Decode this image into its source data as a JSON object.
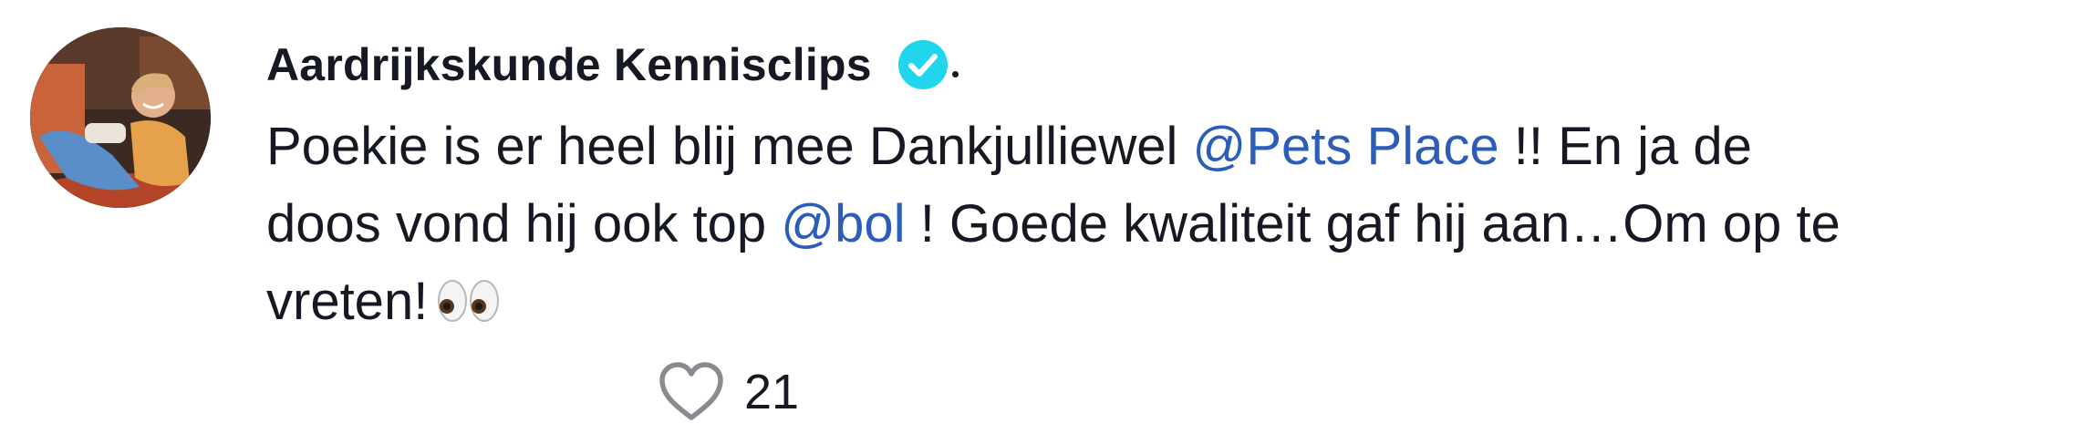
{
  "comment": {
    "author": {
      "name": "Aardrijkskunde Kennisclips",
      "verified": true,
      "verified_color": "#20d5ec",
      "avatar_icon": "avatar-photo"
    },
    "text": {
      "line1_part1": "Poekie is er heel blij mee Dankjulliewel ",
      "mention1": "@Pets Place",
      "line1_part2": " !! En ja de",
      "line2_part1": "doos vond hij ook top ",
      "mention2": "@bol",
      "line2_part2": " ! Goede kwaliteit gaf hij aan…Om op te",
      "line3": "vreten!",
      "emoji": "eyes-icon",
      "mention_color": "#2b5db9"
    },
    "likes": {
      "icon": "heart-outline-icon",
      "count": "21"
    }
  }
}
